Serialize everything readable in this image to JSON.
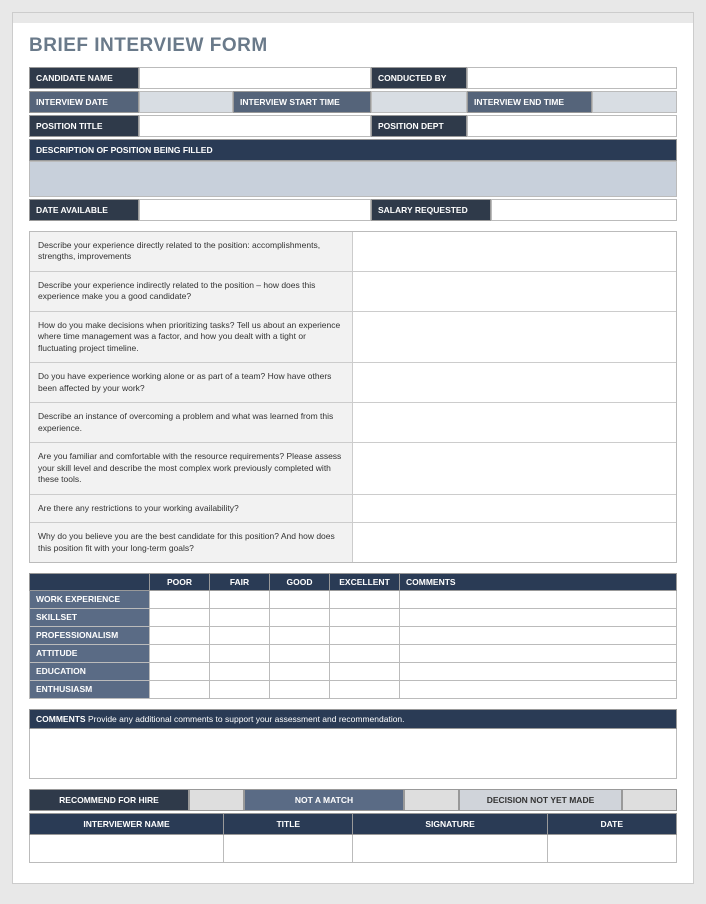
{
  "title": "BRIEF INTERVIEW FORM",
  "header": {
    "candidate_name": "CANDIDATE NAME",
    "conducted_by": "CONDUCTED BY",
    "interview_date": "INTERVIEW DATE",
    "interview_start_time": "INTERVIEW START TIME",
    "interview_end_time": "INTERVIEW END TIME",
    "position_title": "POSITION TITLE",
    "position_dept": "POSITION DEPT",
    "description_label": "DESCRIPTION OF POSITION BEING FILLED",
    "date_available": "DATE AVAILABLE",
    "salary_requested": "SALARY REQUESTED"
  },
  "questions": [
    "Describe your experience directly related to the position: accomplishments, strengths, improvements",
    "Describe your experience indirectly related to the position – how does this experience make you a good candidate?",
    "How do you make decisions when prioritizing tasks? Tell us about an experience where time management was a factor, and how you dealt with a tight or fluctuating project timeline.",
    "Do you have experience working alone or as part of a team? How have others been affected by your work?",
    "Describe an instance of overcoming a problem and what was learned from this experience.",
    "Are you familiar and comfortable with the resource requirements? Please assess your skill level and describe the most complex work previously completed with these tools.",
    "Are there any restrictions to your working availability?",
    "Why do you believe you are the best candidate for this position? And how does this position fit with your long-term goals?"
  ],
  "rating": {
    "cols": [
      "POOR",
      "FAIR",
      "GOOD",
      "EXCELLENT",
      "COMMENTS"
    ],
    "rows": [
      "WORK EXPERIENCE",
      "SKILLSET",
      "PROFESSIONALISM",
      "ATTITUDE",
      "EDUCATION",
      "ENTHUSIASM"
    ]
  },
  "comments": {
    "label": "COMMENTS",
    "text": "Provide any additional comments to support your assessment and recommendation."
  },
  "recommendation": {
    "recommend": "RECOMMEND FOR HIRE",
    "not_match": "NOT A MATCH",
    "not_yet": "DECISION NOT YET MADE"
  },
  "signature": {
    "interviewer": "INTERVIEWER NAME",
    "title": "TITLE",
    "signature": "SIGNATURE",
    "date": "DATE"
  }
}
